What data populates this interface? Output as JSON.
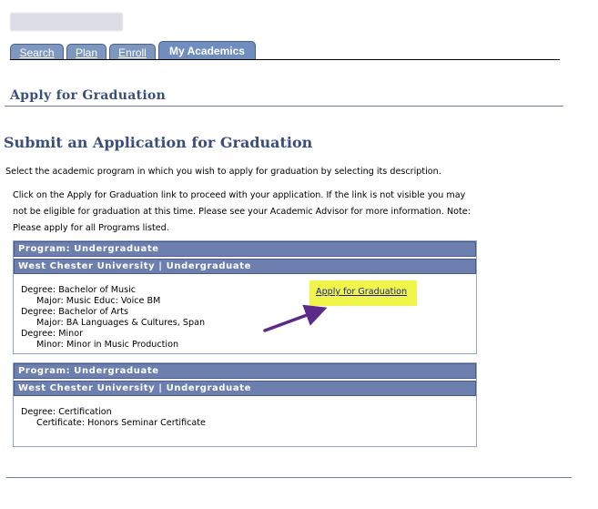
{
  "tabs": [
    {
      "label": "Search",
      "active": false
    },
    {
      "label": "Plan",
      "active": false
    },
    {
      "label": "Enroll",
      "active": false
    },
    {
      "label": "My Academics",
      "active": true
    }
  ],
  "page_title": "Apply for Graduation",
  "heading": "Submit an Application for Graduation",
  "intro": "Select the academic program in which you wish to apply for graduation by selecting its description.",
  "instructions": [
    "Click on the Apply for Graduation link to proceed with your application.  If the link is not visible you may",
    "not be eligible for graduation at this time.  Please see your Academic Advisor for more information. Note:",
    "Please apply for all Programs listed."
  ],
  "programs": [
    {
      "program_header": "Program: Undergraduate",
      "institution_header": "West Chester University | Undergraduate",
      "rows": [
        {
          "text": "Degree: Bachelor of Music",
          "indent": false
        },
        {
          "text": "Major: Music Educ: Voice BM",
          "indent": true
        },
        {
          "text": "Degree: Bachelor of Arts",
          "indent": false
        },
        {
          "text": "Major: BA Languages & Cultures, Span",
          "indent": true
        },
        {
          "text": "Degree: Minor",
          "indent": false
        },
        {
          "text": "Minor: Minor in Music Production",
          "indent": true
        }
      ],
      "apply_link": "Apply for Graduation"
    },
    {
      "program_header": "Program: Undergraduate",
      "institution_header": "West Chester University | Undergraduate",
      "rows": [
        {
          "text": "Degree: Certification",
          "indent": false
        },
        {
          "text": "Certificate: Honors Seminar Certificate",
          "indent": true
        }
      ]
    }
  ],
  "colors": {
    "header_bg": "#6d7fae",
    "title": "#3b4f7f",
    "highlight": "#f0f54a",
    "arrow": "#5b2a8a"
  }
}
